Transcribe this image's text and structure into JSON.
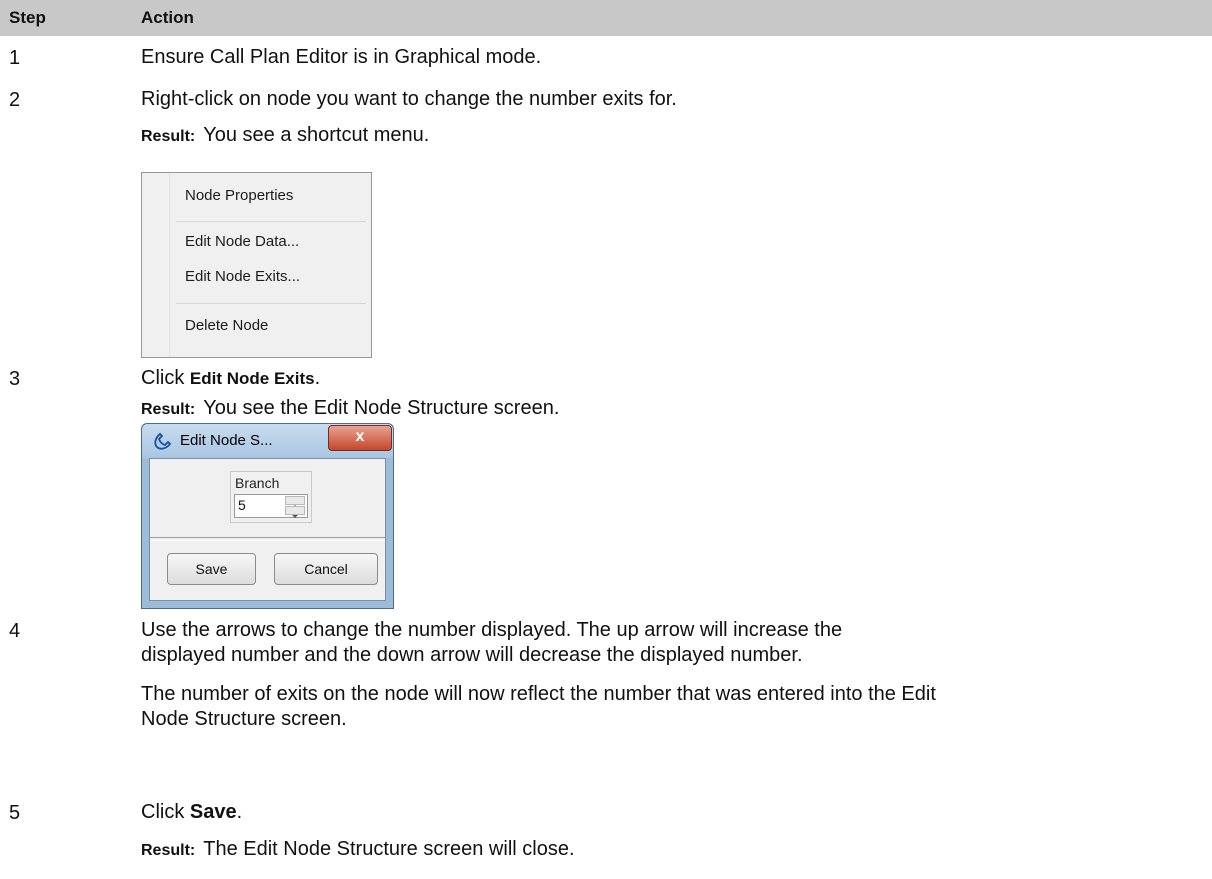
{
  "header": {
    "step": "Step",
    "action": "Action"
  },
  "steps": [
    {
      "num": "1",
      "text": "Ensure Call Plan Editor is in Graphical mode."
    },
    {
      "num": "2",
      "text": "Right-click on node you want to change the number exits for.",
      "result_label": "Result:",
      "result_text": "You see a shortcut menu."
    },
    {
      "num": "3",
      "text_pre": "Click ",
      "text_bold": "Edit Node Exits",
      "text_post": ".",
      "result_label": "Result:",
      "result_text": "You see the Edit Node Structure screen."
    },
    {
      "num": "4",
      "line1": "Use the arrows to change the number displayed.  The up arrow will increase the",
      "line2": "displayed number and the down arrow will decrease the displayed number.",
      "line3": "The number of exits on the node will now reflect the number that was entered into the Edit",
      "line4": "Node Structure screen."
    },
    {
      "num": "5",
      "text_pre": "Click ",
      "text_bold": "Save",
      "text_post": ".",
      "result_label": "Result:",
      "result_text": "The Edit Node Structure screen will close."
    }
  ],
  "context_menu": {
    "items": [
      "Node Properties",
      "Edit Node Data...",
      "Edit Node Exits...",
      "Delete Node"
    ]
  },
  "dialog": {
    "title": "Edit Node S...",
    "close_glyph": "x",
    "group_label": "Branch",
    "spinner_value": "5",
    "save_label": "Save",
    "cancel_label": "Cancel"
  }
}
